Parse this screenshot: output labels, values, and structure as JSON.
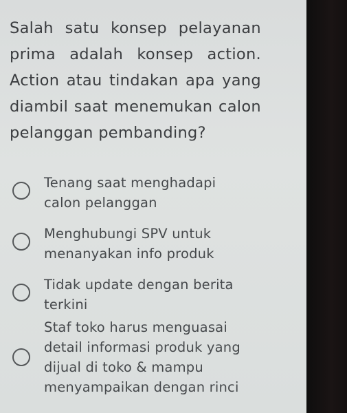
{
  "question": {
    "text": "Salah satu konsep pelayanan prima adalah konsep action. Action atau tindakan apa yang diambil saat menemukan calon pelanggan pembanding?"
  },
  "options": [
    {
      "label": "Tenang saat menghadapi calon pelanggan",
      "selected": false
    },
    {
      "label": "Menghubungi SPV untuk menanyakan info produk",
      "selected": false
    },
    {
      "label": "Tidak update dengan berita terkini",
      "selected": false
    },
    {
      "label": "Staf toko harus menguasai detail informasi produk yang dijual di toko & mampu menyampaikan dengan rinci",
      "selected": false
    }
  ]
}
